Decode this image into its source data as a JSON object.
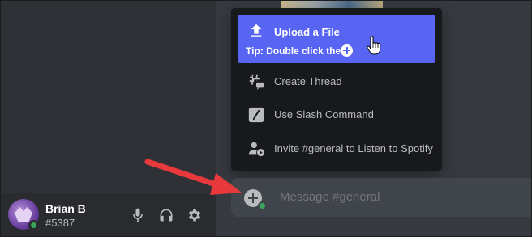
{
  "user": {
    "name": "Brian B",
    "tag": "#5387",
    "status_color": "#3ba55c"
  },
  "user_controls": [
    {
      "icon": "microphone-icon"
    },
    {
      "icon": "headphones-icon"
    },
    {
      "icon": "gear-icon"
    }
  ],
  "menu": {
    "items": [
      {
        "label": "Upload a File",
        "icon": "upload-icon",
        "active": true
      },
      {
        "label": "Create Thread",
        "icon": "thread-icon"
      },
      {
        "label": "Use Slash Command",
        "icon": "slash-command-icon"
      },
      {
        "label": "Invite #general to Listen to Spotify",
        "icon": "spotify-invite-icon"
      }
    ],
    "tip": "Tip: Double click the"
  },
  "composer": {
    "placeholder": "Message #general"
  },
  "colors": {
    "accent": "#5865f2",
    "annotation_arrow": "#e8393c"
  }
}
